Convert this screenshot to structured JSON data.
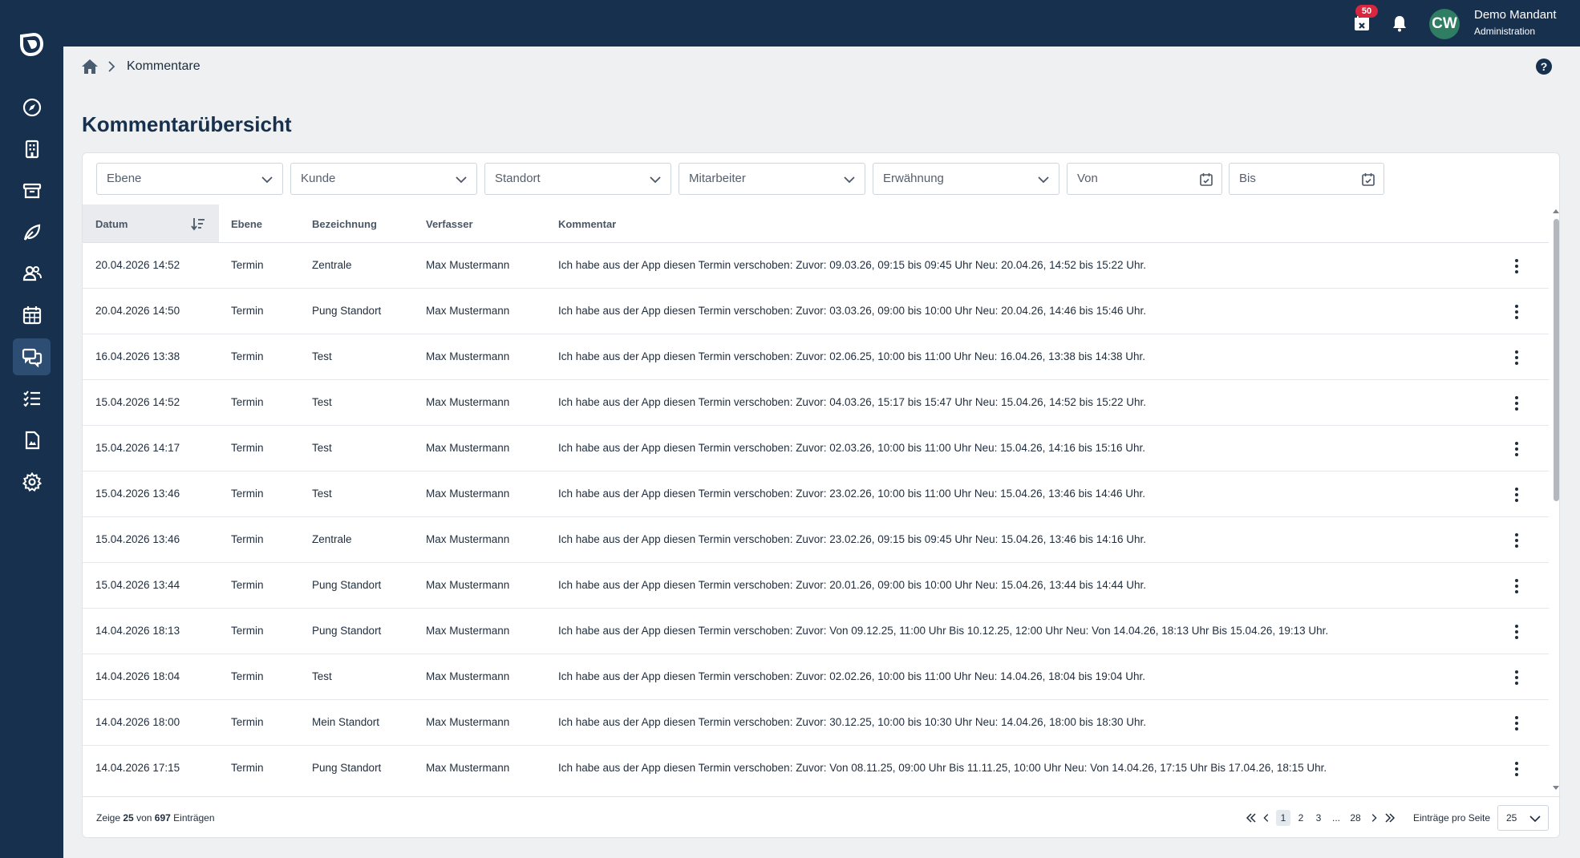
{
  "header": {
    "notification_count": "50",
    "avatar_initials": "CW",
    "user_name": "Demo Mandant",
    "user_role": "Administration"
  },
  "breadcrumb": {
    "current": "Kommentare"
  },
  "page": {
    "title": "Kommentarübersicht"
  },
  "filters": {
    "ebene": "Ebene",
    "kunde": "Kunde",
    "standort": "Standort",
    "mitarbeiter": "Mitarbeiter",
    "erwaehnung": "Erwähnung",
    "von": "Von",
    "bis": "Bis"
  },
  "table": {
    "columns": {
      "datum": "Datum",
      "ebene": "Ebene",
      "bezeichnung": "Bezeichnung",
      "verfasser": "Verfasser",
      "kommentar": "Kommentar"
    },
    "rows": [
      {
        "datum": "20.04.2026 14:52",
        "ebene": "Termin",
        "bezeichnung": "Zentrale",
        "verfasser": "Max Mustermann",
        "kommentar": "Ich habe aus der App diesen Termin verschoben: Zuvor: 09.03.26, 09:15 bis 09:45 Uhr Neu: 20.04.26, 14:52 bis 15:22 Uhr."
      },
      {
        "datum": "20.04.2026 14:50",
        "ebene": "Termin",
        "bezeichnung": "Pung Standort",
        "verfasser": "Max Mustermann",
        "kommentar": "Ich habe aus der App diesen Termin verschoben: Zuvor: 03.03.26, 09:00 bis 10:00 Uhr Neu: 20.04.26, 14:46 bis 15:46 Uhr."
      },
      {
        "datum": "16.04.2026 13:38",
        "ebene": "Termin",
        "bezeichnung": "Test",
        "verfasser": "Max Mustermann",
        "kommentar": "Ich habe aus der App diesen Termin verschoben: Zuvor: 02.06.25, 10:00 bis 11:00 Uhr Neu: 16.04.26, 13:38 bis 14:38 Uhr."
      },
      {
        "datum": "15.04.2026 14:52",
        "ebene": "Termin",
        "bezeichnung": "Test",
        "verfasser": "Max Mustermann",
        "kommentar": "Ich habe aus der App diesen Termin verschoben: Zuvor: 04.03.26, 15:17 bis 15:47 Uhr Neu: 15.04.26, 14:52 bis 15:22 Uhr."
      },
      {
        "datum": "15.04.2026 14:17",
        "ebene": "Termin",
        "bezeichnung": "Test",
        "verfasser": "Max Mustermann",
        "kommentar": "Ich habe aus der App diesen Termin verschoben: Zuvor: 02.03.26, 10:00 bis 11:00 Uhr Neu: 15.04.26, 14:16 bis 15:16 Uhr."
      },
      {
        "datum": "15.04.2026 13:46",
        "ebene": "Termin",
        "bezeichnung": "Test",
        "verfasser": "Max Mustermann",
        "kommentar": "Ich habe aus der App diesen Termin verschoben: Zuvor: 23.02.26, 10:00 bis 11:00 Uhr Neu: 15.04.26, 13:46 bis 14:46 Uhr."
      },
      {
        "datum": "15.04.2026 13:46",
        "ebene": "Termin",
        "bezeichnung": "Zentrale",
        "verfasser": "Max Mustermann",
        "kommentar": "Ich habe aus der App diesen Termin verschoben: Zuvor: 23.02.26, 09:15 bis 09:45 Uhr Neu: 15.04.26, 13:46 bis 14:16 Uhr."
      },
      {
        "datum": "15.04.2026 13:44",
        "ebene": "Termin",
        "bezeichnung": "Pung Standort",
        "verfasser": "Max Mustermann",
        "kommentar": "Ich habe aus der App diesen Termin verschoben: Zuvor: 20.01.26, 09:00 bis 10:00 Uhr Neu: 15.04.26, 13:44 bis 14:44 Uhr."
      },
      {
        "datum": "14.04.2026 18:13",
        "ebene": "Termin",
        "bezeichnung": "Pung Standort",
        "verfasser": "Max Mustermann",
        "kommentar": "Ich habe aus der App diesen Termin verschoben: Zuvor: Von 09.12.25, 11:00 Uhr Bis 10.12.25, 12:00 Uhr Neu: Von 14.04.26, 18:13 Uhr Bis 15.04.26, 19:13 Uhr."
      },
      {
        "datum": "14.04.2026 18:04",
        "ebene": "Termin",
        "bezeichnung": "Test",
        "verfasser": "Max Mustermann",
        "kommentar": "Ich habe aus der App diesen Termin verschoben: Zuvor: 02.02.26, 10:00 bis 11:00 Uhr Neu: 14.04.26, 18:04 bis 19:04 Uhr."
      },
      {
        "datum": "14.04.2026 18:00",
        "ebene": "Termin",
        "bezeichnung": "Mein Standort",
        "verfasser": "Max Mustermann",
        "kommentar": "Ich habe aus der App diesen Termin verschoben: Zuvor: 30.12.25, 10:00 bis 10:30 Uhr Neu: 14.04.26, 18:00 bis 18:30 Uhr."
      },
      {
        "datum": "14.04.2026 17:15",
        "ebene": "Termin",
        "bezeichnung": "Pung Standort",
        "verfasser": "Max Mustermann",
        "kommentar": "Ich habe aus der App diesen Termin verschoben: Zuvor: Von 08.11.25, 09:00 Uhr Bis 11.11.25, 10:00 Uhr Neu: Von 14.04.26, 17:15 Uhr Bis 17.04.26, 18:15 Uhr."
      }
    ]
  },
  "footer": {
    "entries_prefix": "Zeige",
    "entries_shown": "25",
    "entries_mid": "von",
    "entries_total": "697",
    "entries_suffix": "Einträgen",
    "pages": [
      "1",
      "2",
      "3",
      "...",
      "28"
    ],
    "per_page_label": "Einträge pro Seite",
    "per_page_value": "25"
  }
}
